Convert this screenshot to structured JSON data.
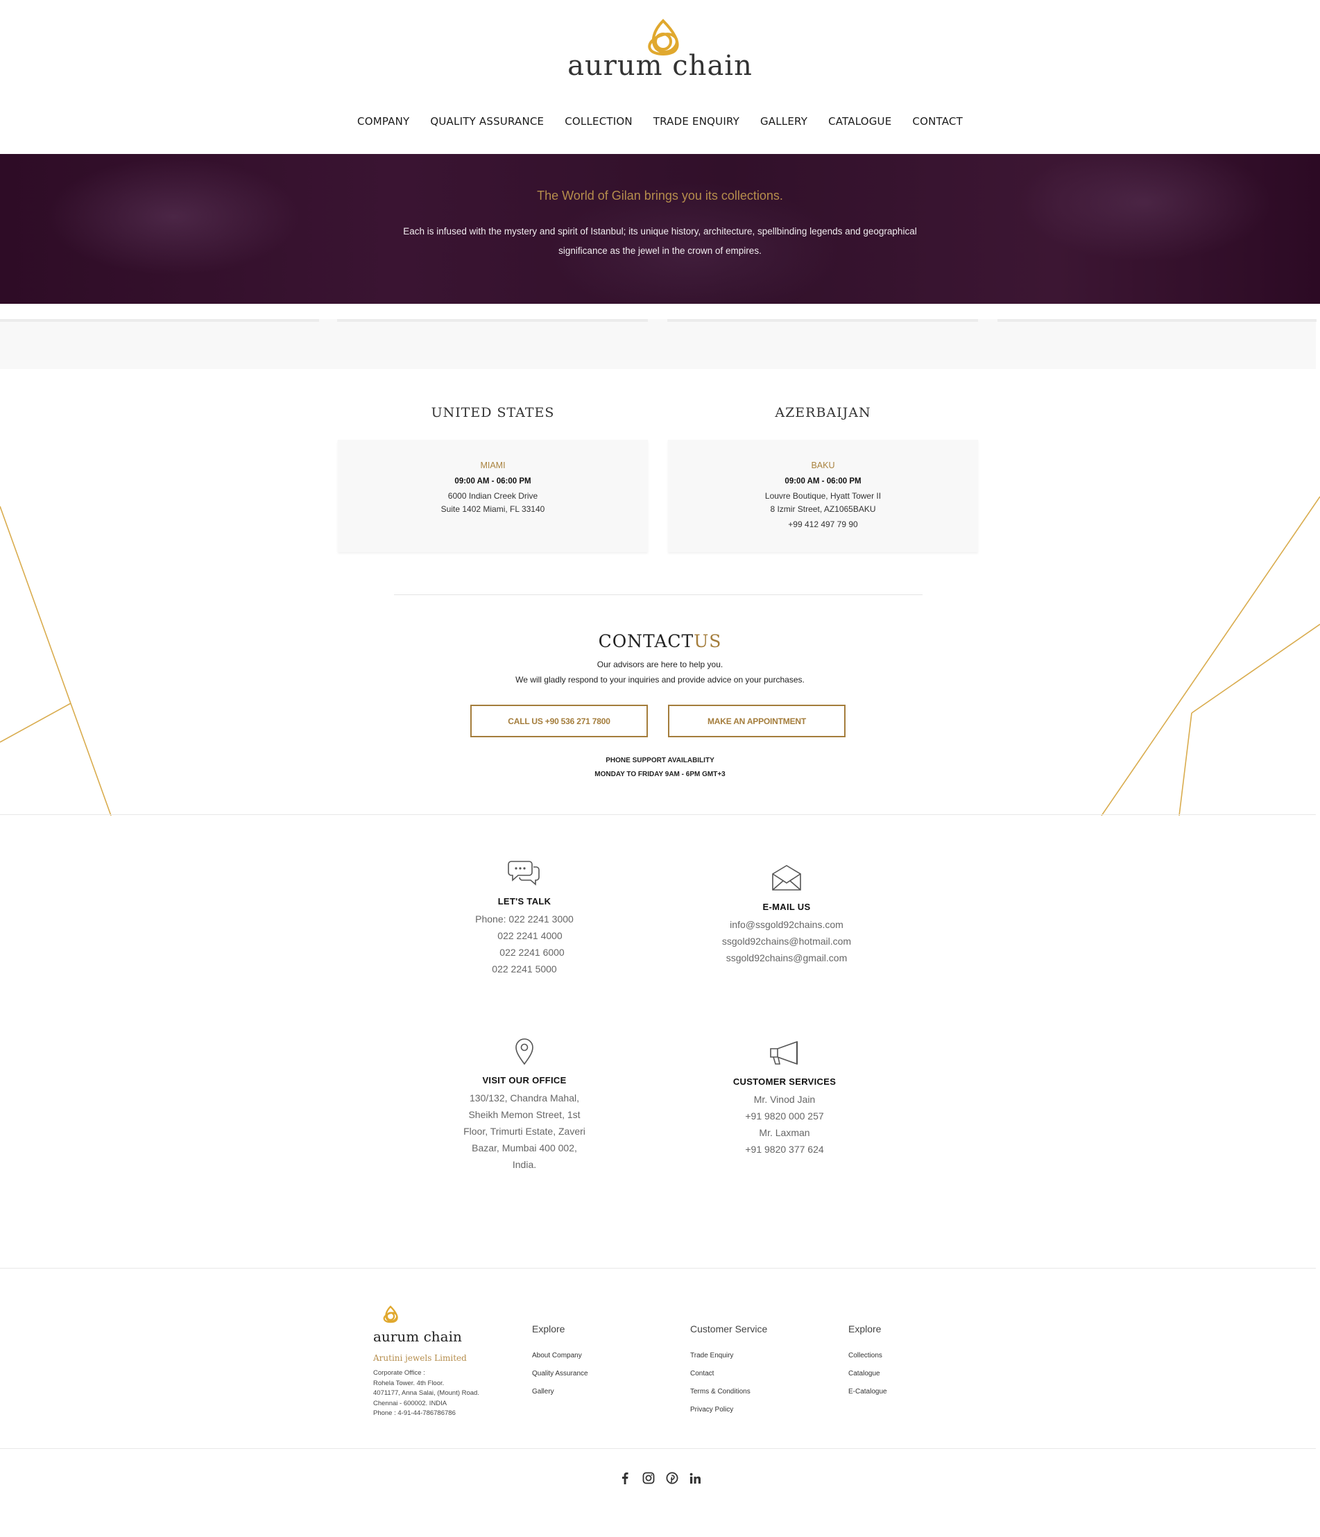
{
  "brand": {
    "name": "aurum chain",
    "accent": "#a47d3c",
    "hero_bg": "#33102c"
  },
  "nav": [
    "COMPANY",
    "QUALITY ASSURANCE",
    "COLLECTION",
    "TRADE ENQUIRY",
    "GALLERY",
    "CATALOGUE",
    "CONTACT"
  ],
  "hero": {
    "title": "The World of Gilan brings you its collections.",
    "text": "Each is infused with the mystery and spirit of Istanbul; its unique history, architecture, spellbinding legends and geographical significance as the jewel in the crown of empires."
  },
  "locations": [
    {
      "country": "UNITED STATES",
      "city": "MIAMI",
      "hours": "09:00 AM - 06:00 PM",
      "lines": [
        "6000 Indian Creek Drive",
        "Suite 1402 Miami, FL 33140"
      ],
      "phone": ""
    },
    {
      "country": "AZERBAIJAN",
      "city": "BAKU",
      "hours": "09:00 AM - 06:00 PM",
      "lines": [
        "Louvre Boutique, Hyatt Tower II",
        "8 Izmir Street, AZ1065BAKU"
      ],
      "phone": "+99 412 497 79 90"
    }
  ],
  "contact_us": {
    "title_main": "CONTACT",
    "title_accent": "US",
    "line1": "Our advisors are here to help you.",
    "line2": "We will gladly respond to your inquiries and provide advice on your purchases.",
    "call_button": "CALL US +90 536 271 7800",
    "appointment_button": "MAKE AN APPOINTMENT",
    "support_title": "PHONE SUPPORT AVAILABILITY",
    "support_hours": "MONDAY TO FRIDAY 9AM - 6PM GMT+3"
  },
  "info": {
    "talk": {
      "icon": "chat-bubbles-icon",
      "title": "LET'S TALK",
      "lines": [
        "Phone: 022 2241 3000",
        "022 2241 4000",
        "022 2241 6000",
        "022 2241 5000"
      ]
    },
    "email": {
      "icon": "envelope-icon",
      "title": "E-MAIL US",
      "lines": [
        "info@ssgold92chains.com",
        "ssgold92chains@hotmail.com",
        "ssgold92chains@gmail.com"
      ]
    },
    "office": {
      "icon": "map-pin-icon",
      "title": "VISIT OUR OFFICE",
      "lines": [
        "130/132, Chandra Mahal,",
        "Sheikh Memon Street, 1st",
        "Floor, Trimurti Estate, Zaveri",
        "Bazar, Mumbai 400 002,",
        "India."
      ]
    },
    "service": {
      "icon": "megaphone-icon",
      "title": "CUSTOMER SERVICES",
      "lines": [
        "Mr. Vinod Jain",
        "+91 9820 000 257",
        "Mr. Laxman",
        "+91 9820 377 624"
      ]
    }
  },
  "footer": {
    "logo_text": "aurum chain",
    "company": "Arutini jewels Limited",
    "address": [
      "Corporate Office :",
      "Rohela Tower. 4th Floor.",
      "4071177, Anna Salai, (Mount) Road.",
      "Chennai - 600002. INDIA",
      "Phone : 4-91-44-786786786"
    ],
    "columns": [
      {
        "title": "Explore",
        "links": [
          "About Company",
          "Quality Assurance",
          "Gallery"
        ]
      },
      {
        "title": "Customer Service",
        "links": [
          "Trade Enquiry",
          "Contact",
          "Terms & Conditions",
          "Privacy Policy"
        ]
      },
      {
        "title": "Explore",
        "links": [
          "Collections",
          "Catalogue",
          "E-Catalogue"
        ]
      }
    ],
    "social": [
      "facebook-icon",
      "instagram-icon",
      "pinterest-icon",
      "linkedin-icon"
    ]
  }
}
